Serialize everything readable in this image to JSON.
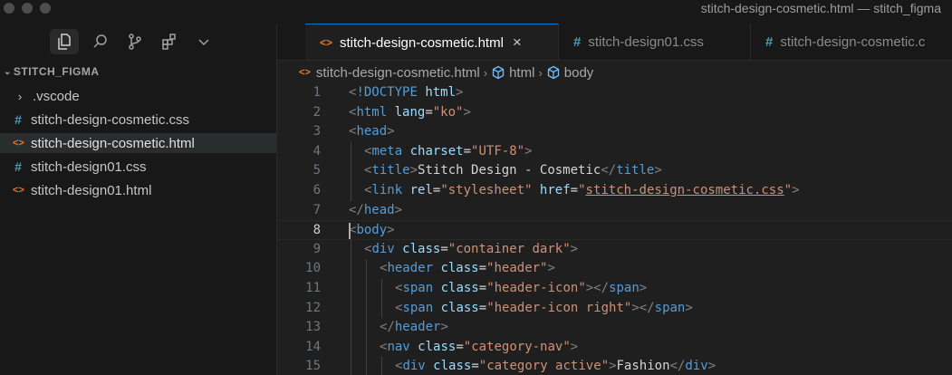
{
  "window": {
    "title": "stitch-design-cosmetic.html — stitch_figma"
  },
  "sidebar": {
    "icons": [
      "explorer-icon",
      "search-icon",
      "source-control-icon",
      "extensions-icon",
      "chevron-down-icon"
    ],
    "explorer_title": "STITCH_FIGMA",
    "items": [
      {
        "label": ".vscode",
        "type": "folder"
      },
      {
        "label": "stitch-design-cosmetic.css",
        "type": "css"
      },
      {
        "label": "stitch-design-cosmetic.html",
        "type": "html",
        "selected": true
      },
      {
        "label": "stitch-design01.css",
        "type": "css"
      },
      {
        "label": "stitch-design01.html",
        "type": "html"
      }
    ]
  },
  "tabs": [
    {
      "label": "stitch-design-cosmetic.html",
      "type": "html",
      "active": true
    },
    {
      "label": "stitch-design01.css",
      "type": "css"
    },
    {
      "label": "stitch-design-cosmetic.c",
      "type": "css"
    }
  ],
  "breadcrumb": [
    "stitch-design-cosmetic.html",
    "html",
    "body"
  ],
  "editor": {
    "current_line": 8,
    "lines": [
      {
        "n": "1",
        "indent": 0,
        "tokens": [
          [
            "punc",
            "<"
          ],
          [
            "doc",
            "!DOCTYPE"
          ],
          [
            "text",
            " "
          ],
          [
            "attr",
            "html"
          ],
          [
            "punc",
            ">"
          ]
        ]
      },
      {
        "n": "2",
        "indent": 0,
        "tokens": [
          [
            "punc",
            "<"
          ],
          [
            "tag",
            "html"
          ],
          [
            "text",
            " "
          ],
          [
            "attr",
            "lang"
          ],
          [
            "text",
            "="
          ],
          [
            "str",
            "\"ko\""
          ],
          [
            "punc",
            ">"
          ]
        ]
      },
      {
        "n": "3",
        "indent": 0,
        "tokens": [
          [
            "punc",
            "<"
          ],
          [
            "tag",
            "head"
          ],
          [
            "punc",
            ">"
          ]
        ]
      },
      {
        "n": "4",
        "indent": 1,
        "tokens": [
          [
            "punc",
            "<"
          ],
          [
            "tag",
            "meta"
          ],
          [
            "text",
            " "
          ],
          [
            "attr",
            "charset"
          ],
          [
            "text",
            "="
          ],
          [
            "str",
            "\"UTF-8\""
          ],
          [
            "punc",
            ">"
          ]
        ]
      },
      {
        "n": "5",
        "indent": 1,
        "tokens": [
          [
            "punc",
            "<"
          ],
          [
            "tag",
            "title"
          ],
          [
            "punc",
            ">"
          ],
          [
            "text",
            "Stitch Design - Cosmetic"
          ],
          [
            "punc",
            "</"
          ],
          [
            "tag",
            "title"
          ],
          [
            "punc",
            ">"
          ]
        ]
      },
      {
        "n": "6",
        "indent": 1,
        "tokens": [
          [
            "punc",
            "<"
          ],
          [
            "tag",
            "link"
          ],
          [
            "text",
            " "
          ],
          [
            "attr",
            "rel"
          ],
          [
            "text",
            "="
          ],
          [
            "str",
            "\"stylesheet\""
          ],
          [
            "text",
            " "
          ],
          [
            "attr",
            "href"
          ],
          [
            "text",
            "="
          ],
          [
            "str",
            "\""
          ],
          [
            "link",
            "stitch-design-cosmetic.css"
          ],
          [
            "str",
            "\""
          ],
          [
            "punc",
            ">"
          ]
        ]
      },
      {
        "n": "7",
        "indent": 0,
        "tokens": [
          [
            "punc",
            "</"
          ],
          [
            "tag",
            "head"
          ],
          [
            "punc",
            ">"
          ]
        ]
      },
      {
        "n": "8",
        "indent": 0,
        "tokens": [
          [
            "punc",
            "<"
          ],
          [
            "tag",
            "body"
          ],
          [
            "punc",
            ">"
          ]
        ]
      },
      {
        "n": "9",
        "indent": 1,
        "tokens": [
          [
            "punc",
            "<"
          ],
          [
            "tag",
            "div"
          ],
          [
            "text",
            " "
          ],
          [
            "attr",
            "class"
          ],
          [
            "text",
            "="
          ],
          [
            "str",
            "\"container dark\""
          ],
          [
            "punc",
            ">"
          ]
        ]
      },
      {
        "n": "10",
        "indent": 2,
        "tokens": [
          [
            "punc",
            "<"
          ],
          [
            "tag",
            "header"
          ],
          [
            "text",
            " "
          ],
          [
            "attr",
            "class"
          ],
          [
            "text",
            "="
          ],
          [
            "str",
            "\"header\""
          ],
          [
            "punc",
            ">"
          ]
        ]
      },
      {
        "n": "11",
        "indent": 3,
        "tokens": [
          [
            "punc",
            "<"
          ],
          [
            "tag",
            "span"
          ],
          [
            "text",
            " "
          ],
          [
            "attr",
            "class"
          ],
          [
            "text",
            "="
          ],
          [
            "str",
            "\"header-icon\""
          ],
          [
            "punc",
            "></"
          ],
          [
            "tag",
            "span"
          ],
          [
            "punc",
            ">"
          ]
        ]
      },
      {
        "n": "12",
        "indent": 3,
        "tokens": [
          [
            "punc",
            "<"
          ],
          [
            "tag",
            "span"
          ],
          [
            "text",
            " "
          ],
          [
            "attr",
            "class"
          ],
          [
            "text",
            "="
          ],
          [
            "str",
            "\"header-icon right\""
          ],
          [
            "punc",
            "></"
          ],
          [
            "tag",
            "span"
          ],
          [
            "punc",
            ">"
          ]
        ]
      },
      {
        "n": "13",
        "indent": 2,
        "tokens": [
          [
            "punc",
            "</"
          ],
          [
            "tag",
            "header"
          ],
          [
            "punc",
            ">"
          ]
        ]
      },
      {
        "n": "14",
        "indent": 2,
        "tokens": [
          [
            "punc",
            "<"
          ],
          [
            "tag",
            "nav"
          ],
          [
            "text",
            " "
          ],
          [
            "attr",
            "class"
          ],
          [
            "text",
            "="
          ],
          [
            "str",
            "\"category-nav\""
          ],
          [
            "punc",
            ">"
          ]
        ]
      },
      {
        "n": "15",
        "indent": 3,
        "tokens": [
          [
            "punc",
            "<"
          ],
          [
            "tag",
            "div"
          ],
          [
            "text",
            " "
          ],
          [
            "attr",
            "class"
          ],
          [
            "text",
            "="
          ],
          [
            "str",
            "\"category active\""
          ],
          [
            "punc",
            ">"
          ],
          [
            "text",
            "Fashion"
          ],
          [
            "punc",
            "</"
          ],
          [
            "tag",
            "div"
          ],
          [
            "punc",
            ">"
          ]
        ]
      }
    ]
  },
  "colors": {
    "accent": "#0078d4",
    "html_icon": "#e37933",
    "css_icon": "#519aba"
  }
}
